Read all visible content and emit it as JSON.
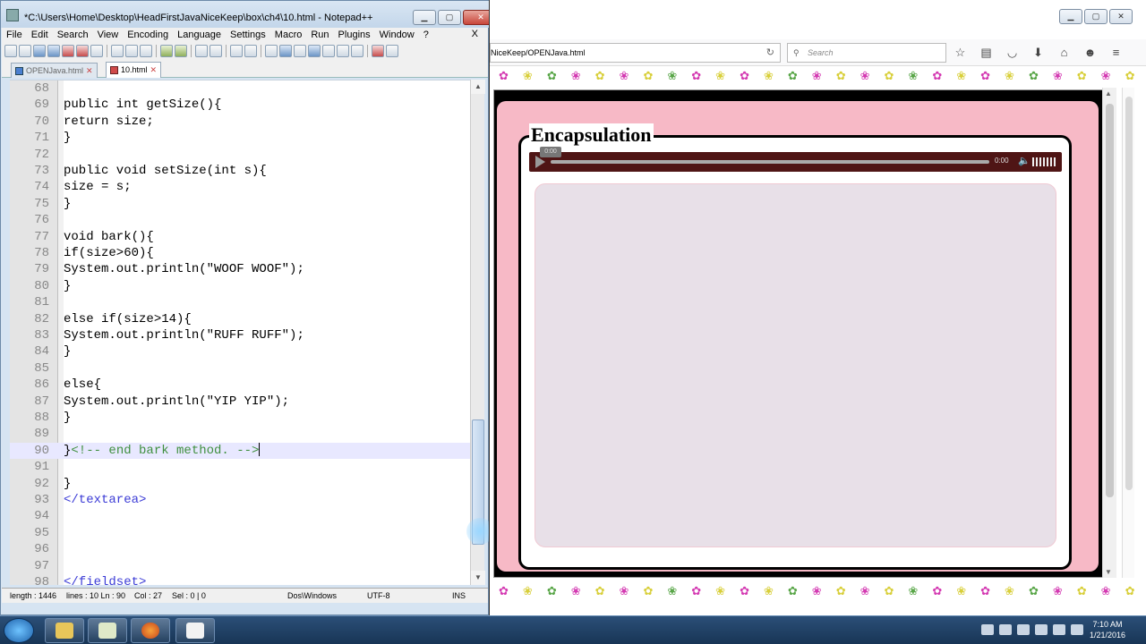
{
  "npp": {
    "title": "*C:\\Users\\Home\\Desktop\\HeadFirstJavaNiceKeep\\box\\ch4\\10.html - Notepad++",
    "menu": [
      "File",
      "Edit",
      "Search",
      "View",
      "Encoding",
      "Language",
      "Settings",
      "Macro",
      "Run",
      "Plugins",
      "Window",
      "?"
    ],
    "menu_close": "X",
    "tabs": [
      {
        "label": "OPENJava.html",
        "close": "✕"
      },
      {
        "label": "10.html",
        "close": "✕"
      }
    ],
    "lines": [
      {
        "n": "68",
        "text": ""
      },
      {
        "n": "69",
        "text": "public int getSize(){"
      },
      {
        "n": "70",
        "text": "return size;"
      },
      {
        "n": "71",
        "text": "}"
      },
      {
        "n": "72",
        "text": ""
      },
      {
        "n": "73",
        "text": "public void setSize(int s){"
      },
      {
        "n": "74",
        "text": "size = s;"
      },
      {
        "n": "75",
        "text": "}"
      },
      {
        "n": "76",
        "text": ""
      },
      {
        "n": "77",
        "text": "void bark(){"
      },
      {
        "n": "78",
        "text": "if(size>60){"
      },
      {
        "n": "79",
        "text": "System.out.println(\"WOOF WOOF\");"
      },
      {
        "n": "80",
        "text": "}"
      },
      {
        "n": "81",
        "text": ""
      },
      {
        "n": "82",
        "text": "else if(size>14){"
      },
      {
        "n": "83",
        "text": "System.out.println(\"RUFF RUFF\");"
      },
      {
        "n": "84",
        "text": "}"
      },
      {
        "n": "85",
        "text": ""
      },
      {
        "n": "86",
        "text": "else{"
      },
      {
        "n": "87",
        "text": "System.out.println(\"YIP YIP\");"
      },
      {
        "n": "88",
        "text": "}"
      },
      {
        "n": "89",
        "text": ""
      },
      {
        "n": "90",
        "brace": "}",
        "comment": "<!-- end bark method. -->"
      },
      {
        "n": "91",
        "text": ""
      },
      {
        "n": "92",
        "text": "}"
      },
      {
        "n": "93",
        "tag": "</textarea>"
      },
      {
        "n": "94",
        "text": ""
      },
      {
        "n": "95",
        "text": ""
      },
      {
        "n": "96",
        "text": ""
      },
      {
        "n": "97",
        "text": ""
      },
      {
        "n": "98",
        "tag": "</fieldset>"
      }
    ],
    "status": {
      "length": "length : 1446",
      "lines": "lines : 10  Ln : 90",
      "col": "Col : 27",
      "sel": "Sel : 0 | 0",
      "eol": "Dos\\Windows",
      "encoding": "UTF-8",
      "mode": "INS"
    }
  },
  "browser": {
    "url": "NiceKeep/OPENJava.html",
    "search_placeholder": "Search",
    "icons": [
      "star-icon",
      "clipboard-icon",
      "pocket-icon",
      "download-icon",
      "home-icon",
      "chat-icon",
      "menu-icon"
    ],
    "page": {
      "legend": "Encapsulation",
      "audio_tooltip": "0:00",
      "audio_time": "0:00"
    }
  },
  "taskbar": {
    "time": "7:10 AM",
    "date": "1/21/2016"
  },
  "colors": {
    "accent_pink": "#f7b9c6",
    "audio_bg": "#4f1515",
    "tag_blue": "#3b3bd6",
    "comment_green": "#3f8f3f"
  }
}
